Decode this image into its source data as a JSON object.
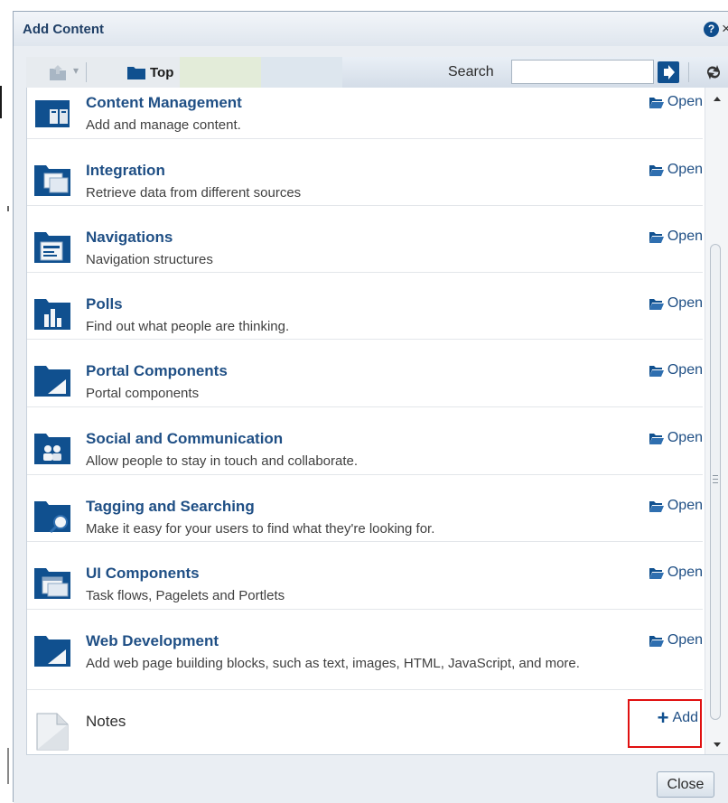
{
  "dialog": {
    "title": "Add Content",
    "help_icon_glyph": "?",
    "close_glyph": "×"
  },
  "toolbar": {
    "breadcrumb": "Top",
    "search_label": "Search",
    "search_value": "",
    "icons": [
      "up-folder-icon",
      "dropdown-arrow-icon",
      "folder-icon",
      "search-go-icon",
      "refresh-icon"
    ]
  },
  "items": [
    {
      "name": "Content Management",
      "desc": "Add and manage content.",
      "action": "Open",
      "icon": "content-management-icon"
    },
    {
      "name": "Integration",
      "desc": "Retrieve data from different sources",
      "action": "Open",
      "icon": "integration-icon"
    },
    {
      "name": "Navigations",
      "desc": "Navigation structures",
      "action": "Open",
      "icon": "navigations-icon"
    },
    {
      "name": "Polls",
      "desc": "Find out what people are thinking.",
      "action": "Open",
      "icon": "polls-icon"
    },
    {
      "name": "Portal Components",
      "desc": "Portal components",
      "action": "Open",
      "icon": "portal-components-icon"
    },
    {
      "name": "Social and Communication",
      "desc": "Allow people to stay in touch and collaborate.",
      "action": "Open",
      "icon": "social-icon"
    },
    {
      "name": "Tagging and Searching",
      "desc": "Make it easy for your users to find what they're looking for.",
      "action": "Open",
      "icon": "tagging-icon"
    },
    {
      "name": "UI Components",
      "desc": "Task flows, Pagelets and Portlets",
      "action": "Open",
      "icon": "ui-components-icon"
    },
    {
      "name": "Web Development",
      "desc": "Add web page building blocks, such as text, images, HTML, JavaScript, and more.",
      "action": "Open",
      "icon": "web-development-icon"
    }
  ],
  "notes": {
    "name": "Notes",
    "action": "Add",
    "icon": "document-icon"
  },
  "footer": {
    "close_label": "Close"
  },
  "colors": {
    "accent": "#10508f",
    "link": "#1f4f85",
    "highlight": "#e01010"
  }
}
